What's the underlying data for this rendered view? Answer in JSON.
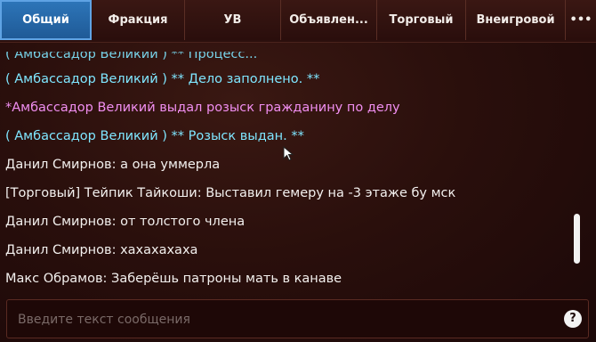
{
  "tabs": [
    {
      "label": "Общий",
      "active": true
    },
    {
      "label": "Фракция",
      "active": false
    },
    {
      "label": "УВ",
      "active": false
    },
    {
      "label": "Объявлен...",
      "active": false
    },
    {
      "label": "Торговый",
      "active": false
    },
    {
      "label": "Внеигровой",
      "active": false
    },
    {
      "label": "•••",
      "active": false
    }
  ],
  "messages": [
    {
      "text": "( Амбассадор Великий ) ** Процесс...",
      "color": "cyan"
    },
    {
      "text": "( Амбассадор Великий ) ** Дело заполнено. **",
      "color": "cyan"
    },
    {
      "text": "*Амбассадор Великий выдал розыск гражданину по делу",
      "color": "pink"
    },
    {
      "text": "( Амбассадор Великий ) ** Розыск выдан. **",
      "color": "cyan"
    },
    {
      "text": "Данил Смирнов: а она уммерла",
      "color": "white"
    },
    {
      "text": "[Торговый] Тейпик Тайкоши: Выставил гемеру на -3 этаже бу мск",
      "color": "white"
    },
    {
      "text": "Данил Смирнов: от толстого члена",
      "color": "white"
    },
    {
      "text": "Данил Смирнов: хахахахаха",
      "color": "white"
    },
    {
      "text": "Макс Обрамов: Заберёшь патроны мать в канаве",
      "color": "white"
    }
  ],
  "input": {
    "placeholder": "Введите текст сообщения",
    "value": ""
  },
  "help_button": {
    "label": "?"
  },
  "colors": {
    "active_tab": "#2d75b8",
    "system": "#7fe6ff",
    "action": "#f08ef0",
    "text": "#f3f0ee"
  },
  "icons": {
    "cursor": "mouse-cursor-icon",
    "help": "help-icon"
  }
}
